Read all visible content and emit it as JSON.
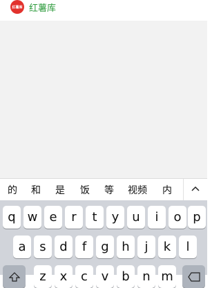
{
  "header": {
    "logo_text": "红薯库",
    "app_name": "红薯库",
    "colors": {
      "logo_bg": "#e2322d",
      "app_name": "#2e9b3d"
    }
  },
  "candidates": [
    "的",
    "和",
    "是",
    "饭",
    "等",
    "视频",
    "内"
  ],
  "candidate_bar": {
    "collapse_icon": "chevron-up-icon"
  },
  "keyboard": {
    "row1": [
      "q",
      "w",
      "e",
      "r",
      "t",
      "y",
      "u",
      "i",
      "o",
      "p"
    ],
    "row2": [
      "a",
      "s",
      "d",
      "f",
      "g",
      "h",
      "j",
      "k",
      "l"
    ],
    "row3": [
      "z",
      "x",
      "c",
      "v",
      "b",
      "n",
      "m"
    ],
    "shift_icon": "shift-icon",
    "delete_icon": "backspace-icon"
  }
}
